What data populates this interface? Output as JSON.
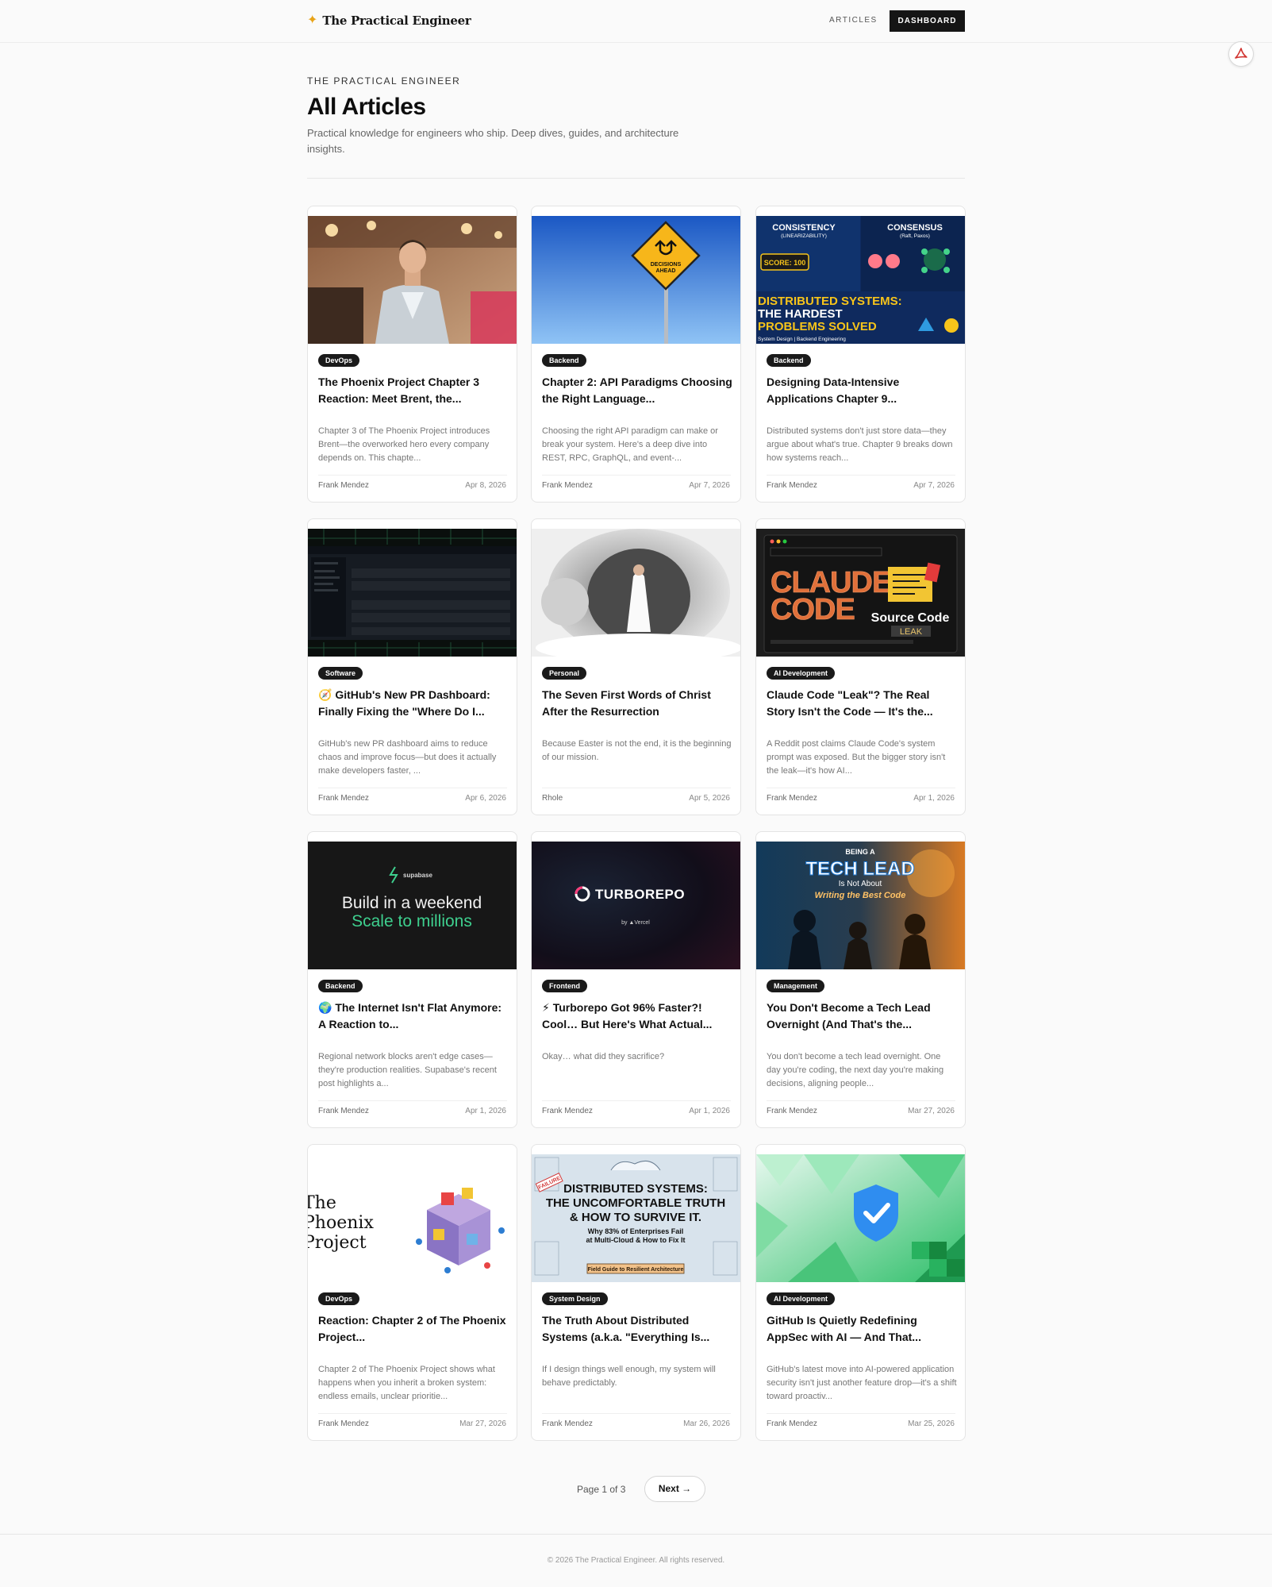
{
  "nav": {
    "brand": "The Practical Engineer",
    "articles_link": "ARTICLES",
    "dashboard_button": "DASHBOARD"
  },
  "header": {
    "eyebrow": "THE PRACTICAL ENGINEER",
    "title": "All Articles",
    "subtitle": "Practical knowledge for engineers who ship. Deep dives, guides, and architecture insights."
  },
  "articles": [
    {
      "tag": "DevOps",
      "title": "The Phoenix Project Chapter 3 Reaction: Meet Brent, the...",
      "excerpt": "Chapter 3 of The Phoenix Project introduces Brent—the overworked hero every company depends on. This chapte...",
      "author": "Frank Mendez",
      "date": "Apr 8, 2026"
    },
    {
      "tag": "Backend",
      "title": "Chapter 2: API Paradigms Choosing the Right Language...",
      "excerpt": "Choosing the right API paradigm can make or break your system. Here's a deep dive into REST, RPC, GraphQL, and event-...",
      "author": "Frank Mendez",
      "date": "Apr 7, 2026",
      "thumb_text": [
        "DECISIONS",
        "AHEAD"
      ]
    },
    {
      "tag": "Backend",
      "title": "Designing Data-Intensive Applications Chapter 9...",
      "excerpt": "Distributed systems don't just store data—they argue about what's true. Chapter 9 breaks down how systems reach...",
      "author": "Frank Mendez",
      "date": "Apr 7, 2026",
      "thumb_text": [
        "CONSISTENCY",
        "(LINEARIZABILITY)",
        "CONSENSUS",
        "(Raft, Paxos)",
        "SCORE: 100",
        "DISTRIBUTED SYSTEMS:",
        "THE HARDEST",
        "PROBLEMS SOLVED",
        "System Design | Backend Engineering"
      ]
    },
    {
      "tag": "Software",
      "title": "🧭 GitHub's New PR Dashboard: Finally Fixing the \"Where Do I...",
      "excerpt": "GitHub's new PR dashboard aims to reduce chaos and improve focus—but does it actually make developers faster, ...",
      "author": "Frank Mendez",
      "date": "Apr 6, 2026"
    },
    {
      "tag": "Personal",
      "title": "The Seven First Words of Christ After the Resurrection",
      "excerpt": "Because Easter is not the end, it is the beginning of our mission.",
      "author": "Rhole",
      "date": "Apr 5, 2026"
    },
    {
      "tag": "AI Development",
      "title": "Claude Code \"Leak\"? The Real Story Isn't the Code — It's the...",
      "excerpt": "A Reddit post claims Claude Code's system prompt was exposed. But the bigger story isn't the leak—it's how AI...",
      "author": "Frank Mendez",
      "date": "Apr 1, 2026",
      "thumb_text": [
        "CLAUDE",
        "CODE",
        "Source Code",
        "LEAK"
      ]
    },
    {
      "tag": "Backend",
      "title": "🌍 The Internet Isn't Flat Anymore: A Reaction to...",
      "excerpt": "Regional network blocks aren't edge cases—they're production realities. Supabase's recent post highlights a...",
      "author": "Frank Mendez",
      "date": "Apr 1, 2026",
      "thumb_text": [
        "supabase",
        "Build in a weekend",
        "Scale to millions"
      ]
    },
    {
      "tag": "Frontend",
      "title": "⚡ Turborepo Got 96% Faster?! Cool… But Here's What Actual...",
      "excerpt": "Okay… what did they sacrifice?",
      "author": "Frank Mendez",
      "date": "Apr 1, 2026",
      "thumb_text": [
        "TURBOREPO",
        "by ▲Vercel"
      ]
    },
    {
      "tag": "Management",
      "title": "You Don't Become a Tech Lead Overnight (And That's the...",
      "excerpt": "You don't become a tech lead overnight. One day you're coding, the next day you're making decisions, aligning people...",
      "author": "Frank Mendez",
      "date": "Mar 27, 2026",
      "thumb_text": [
        "BEING A",
        "TECH LEAD",
        "Is Not About",
        "Writing the Best Code"
      ]
    },
    {
      "tag": "DevOps",
      "title": "Reaction: Chapter 2 of The Phoenix Project...",
      "excerpt": "Chapter 2 of The Phoenix Project shows what happens when you inherit a broken system: endless emails, unclear prioritie...",
      "author": "Frank Mendez",
      "date": "Mar 27, 2026",
      "thumb_text": [
        "The",
        "Phoenix",
        "Project"
      ]
    },
    {
      "tag": "System Design",
      "title": "The Truth About Distributed Systems (a.k.a. \"Everything Is...",
      "excerpt": "If I design things well enough, my system will behave predictably.",
      "author": "Frank Mendez",
      "date": "Mar 26, 2026",
      "thumb_text": [
        "DISTRIBUTED SYSTEMS:",
        "THE UNCOMFORTABLE TRUTH",
        "& HOW TO SURVIVE IT.",
        "Why 83% of Enterprises Fail",
        "at Multi-Cloud & How to Fix It",
        "Field Guide to Resilient Architecture",
        "FAILURE"
      ]
    },
    {
      "tag": "AI Development",
      "title": "GitHub Is Quietly Redefining AppSec with AI — And That...",
      "excerpt": "GitHub's latest move into AI-powered application security isn't just another feature drop—it's a shift toward proactiv...",
      "author": "Frank Mendez",
      "date": "Mar 25, 2026"
    }
  ],
  "pagination": {
    "label": "Page 1 of 3",
    "next": "Next →"
  },
  "footer": {
    "text": "© 2026 The Practical Engineer. All rights reserved."
  },
  "colors": {
    "accent": "#e8a317",
    "dark": "#151515",
    "tag_bg": "#1a1a1a"
  }
}
